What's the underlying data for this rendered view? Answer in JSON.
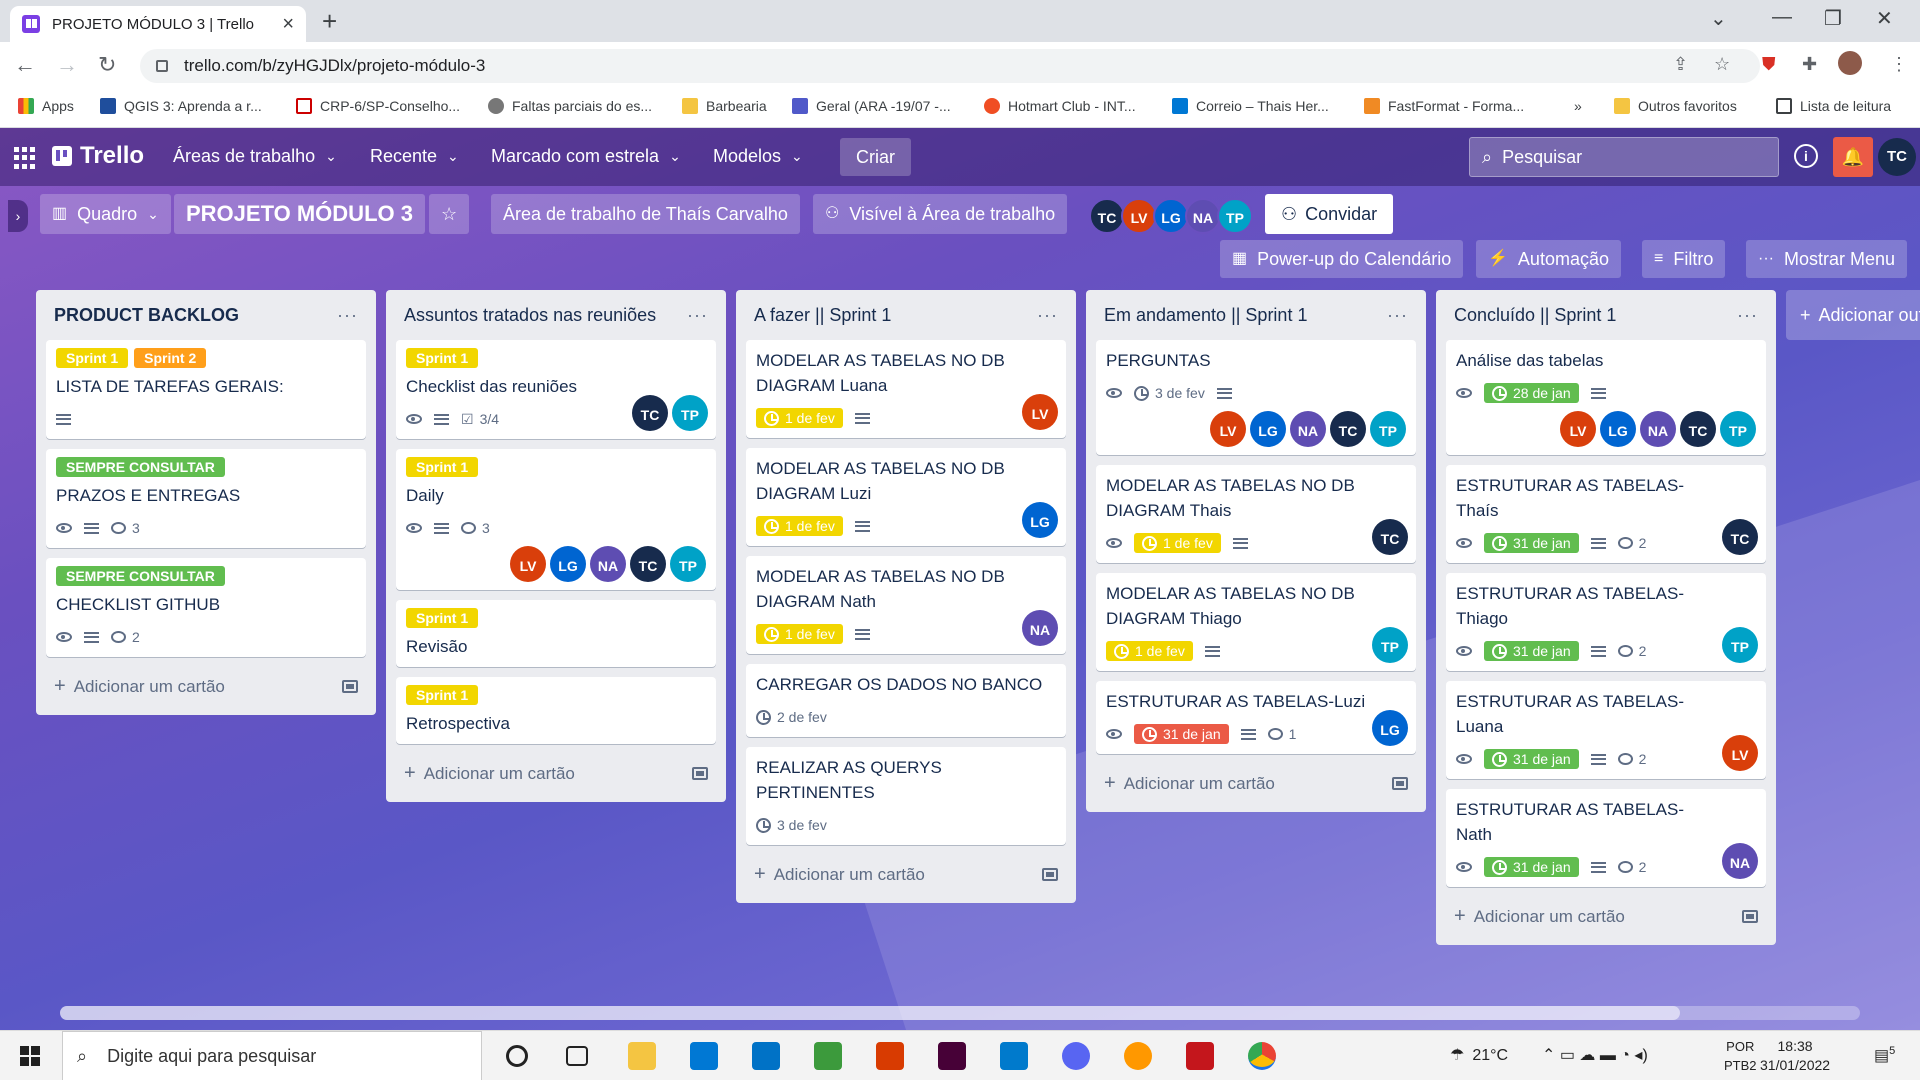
{
  "browser": {
    "tab_title": "PROJETO MÓDULO 3 | Trello",
    "url": "trello.com/b/zyHGJDlx/projeto-módulo-3",
    "bookmarks": [
      "Apps",
      "QGIS 3: Aprenda a r...",
      "CRP-6/SP-Conselho...",
      "Faltas parciais do es...",
      "Barbearia",
      "Geral (ARA -19/07 -...",
      "Hotmart Club - INT...",
      "Correio – Thais Her...",
      "FastFormat - Forma...",
      "»",
      "Outros favoritos",
      "Lista de leitura"
    ]
  },
  "trello": {
    "logo": "Trello",
    "nav": [
      "Áreas de trabalho",
      "Recente",
      "Marcado com estrela",
      "Modelos"
    ],
    "create": "Criar",
    "search_placeholder": "Pesquisar",
    "me": "TC"
  },
  "board": {
    "view": "Quadro",
    "title": "PROJETO MÓDULO 3",
    "workspace": "Área de trabalho de Thaís Carvalho",
    "visibility": "Visível à Área de trabalho",
    "members": [
      "TC",
      "LV",
      "LG",
      "NA",
      "TP"
    ],
    "invite": "Convidar",
    "calendar": "Power-up do Calendário",
    "automation": "Automação",
    "filter": "Filtro",
    "menu": "Mostrar Menu",
    "add_list": "Adicionar outra lista",
    "add_card": "Adicionar um cartão"
  },
  "colors": {
    "TC": "#172b4d",
    "LV": "#d93f0b",
    "LG": "#0065d1",
    "NA": "#5e4db2",
    "TP": "#00a2c7"
  },
  "lists": [
    {
      "title": "PRODUCT BACKLOG",
      "cards": [
        {
          "labels": [
            {
              "text": "Sprint 1",
              "color": "yellow"
            },
            {
              "text": "Sprint 2",
              "color": "orange"
            }
          ],
          "title": "LISTA DE TAREFAS GERAIS:",
          "badges": {
            "desc": true
          }
        },
        {
          "labels": [
            {
              "text": "SEMPRE CONSULTAR",
              "color": "green"
            }
          ],
          "title": "PRAZOS E ENTREGAS",
          "badges": {
            "eye": true,
            "desc": true,
            "comments": "3"
          }
        },
        {
          "labels": [
            {
              "text": "SEMPRE CONSULTAR",
              "color": "green"
            }
          ],
          "title": "CHECKLIST GITHUB",
          "badges": {
            "eye": true,
            "desc": true,
            "comments": "2"
          }
        }
      ]
    },
    {
      "title": "Assuntos tratados nas reuniões",
      "cards": [
        {
          "labels": [
            {
              "text": "Sprint 1",
              "color": "yellow"
            }
          ],
          "title": "Checklist das reuniões",
          "badges": {
            "eye": true,
            "desc": true,
            "checklist": "3/4"
          },
          "members": [
            "TC",
            "TP"
          ],
          "members_inline": true
        },
        {
          "labels": [
            {
              "text": "Sprint 1",
              "color": "yellow"
            }
          ],
          "title": "Daily",
          "badges": {
            "eye": true,
            "desc": true,
            "comments": "3"
          },
          "members": [
            "LV",
            "LG",
            "NA",
            "TC",
            "TP"
          ]
        },
        {
          "labels": [
            {
              "text": "Sprint 1",
              "color": "yellow"
            }
          ],
          "title": "Revisão"
        },
        {
          "labels": [
            {
              "text": "Sprint 1",
              "color": "yellow"
            }
          ],
          "title": "Retrospectiva"
        }
      ]
    },
    {
      "title": "A fazer || Sprint 1",
      "cards": [
        {
          "title": "MODELAR AS TABELAS NO DB DIAGRAM Luana",
          "badges": {
            "due": "1 de fev",
            "due_color": "yellow",
            "desc": true
          },
          "members": [
            "LV"
          ],
          "members_inline": true
        },
        {
          "title": "MODELAR AS TABELAS NO DB DIAGRAM Luzi",
          "badges": {
            "due": "1 de fev",
            "due_color": "yellow",
            "desc": true
          },
          "members": [
            "LG"
          ],
          "members_inline": true
        },
        {
          "title": "MODELAR AS TABELAS NO DB DIAGRAM Nath",
          "badges": {
            "due": "1 de fev",
            "due_color": "yellow",
            "desc": true
          },
          "members": [
            "NA"
          ],
          "members_inline": true
        },
        {
          "title": "CARREGAR OS DADOS NO BANCO",
          "badges": {
            "date": "2 de fev"
          }
        },
        {
          "title": "REALIZAR AS QUERYS PERTINENTES",
          "badges": {
            "date": "3 de fev"
          }
        }
      ]
    },
    {
      "title": "Em andamento || Sprint 1",
      "cards": [
        {
          "title": "PERGUNTAS",
          "badges": {
            "eye": true,
            "date": "3 de fev",
            "desc": true
          },
          "members": [
            "LV",
            "LG",
            "NA",
            "TC",
            "TP"
          ]
        },
        {
          "title": "MODELAR AS TABELAS NO DB DIAGRAM Thais",
          "badges": {
            "eye": true,
            "due": "1 de fev",
            "due_color": "yellow",
            "desc": true
          },
          "members": [
            "TC"
          ],
          "members_inline": true
        },
        {
          "title": "MODELAR AS TABELAS NO DB DIAGRAM Thiago",
          "badges": {
            "due": "1 de fev",
            "due_color": "yellow",
            "desc": true
          },
          "members": [
            "TP"
          ],
          "members_inline": true
        },
        {
          "title": "ESTRUTURAR AS TABELAS-Luzi",
          "badges": {
            "eye": true,
            "due": "31 de jan",
            "due_color": "red",
            "desc": true,
            "comments": "1"
          },
          "members": [
            "LG"
          ],
          "members_inline": true
        }
      ]
    },
    {
      "title": "Concluído || Sprint 1",
      "cards": [
        {
          "title": "Análise das tabelas",
          "badges": {
            "eye": true,
            "due": "28 de jan",
            "due_color": "green",
            "desc": true
          },
          "members": [
            "LV",
            "LG",
            "NA",
            "TC",
            "TP"
          ]
        },
        {
          "title": "ESTRUTURAR AS TABELAS-Thaís",
          "badges": {
            "eye": true,
            "due": "31 de jan",
            "due_color": "green",
            "desc": true,
            "comments": "2"
          },
          "members": [
            "TC"
          ],
          "members_inline": true
        },
        {
          "title": "ESTRUTURAR AS TABELAS-Thiago",
          "badges": {
            "eye": true,
            "due": "31 de jan",
            "due_color": "green",
            "desc": true,
            "comments": "2"
          },
          "members": [
            "TP"
          ],
          "members_inline": true
        },
        {
          "title": "ESTRUTURAR AS TABELAS- Luana",
          "badges": {
            "eye": true,
            "due": "31 de jan",
            "due_color": "green",
            "desc": true,
            "comments": "2"
          },
          "members": [
            "LV"
          ],
          "members_inline": true
        },
        {
          "title": "ESTRUTURAR AS TABELAS-Nath",
          "badges": {
            "eye": true,
            "due": "31 de jan",
            "due_color": "green",
            "desc": true,
            "comments": "2"
          },
          "members": [
            "NA"
          ],
          "members_inline": true
        }
      ]
    }
  ],
  "taskbar": {
    "search": "Digite aqui para pesquisar",
    "weather": "21°C",
    "lang1": "POR",
    "lang2": "PTB2",
    "time": "18:38",
    "date": "31/01/2022",
    "notif": "5"
  }
}
